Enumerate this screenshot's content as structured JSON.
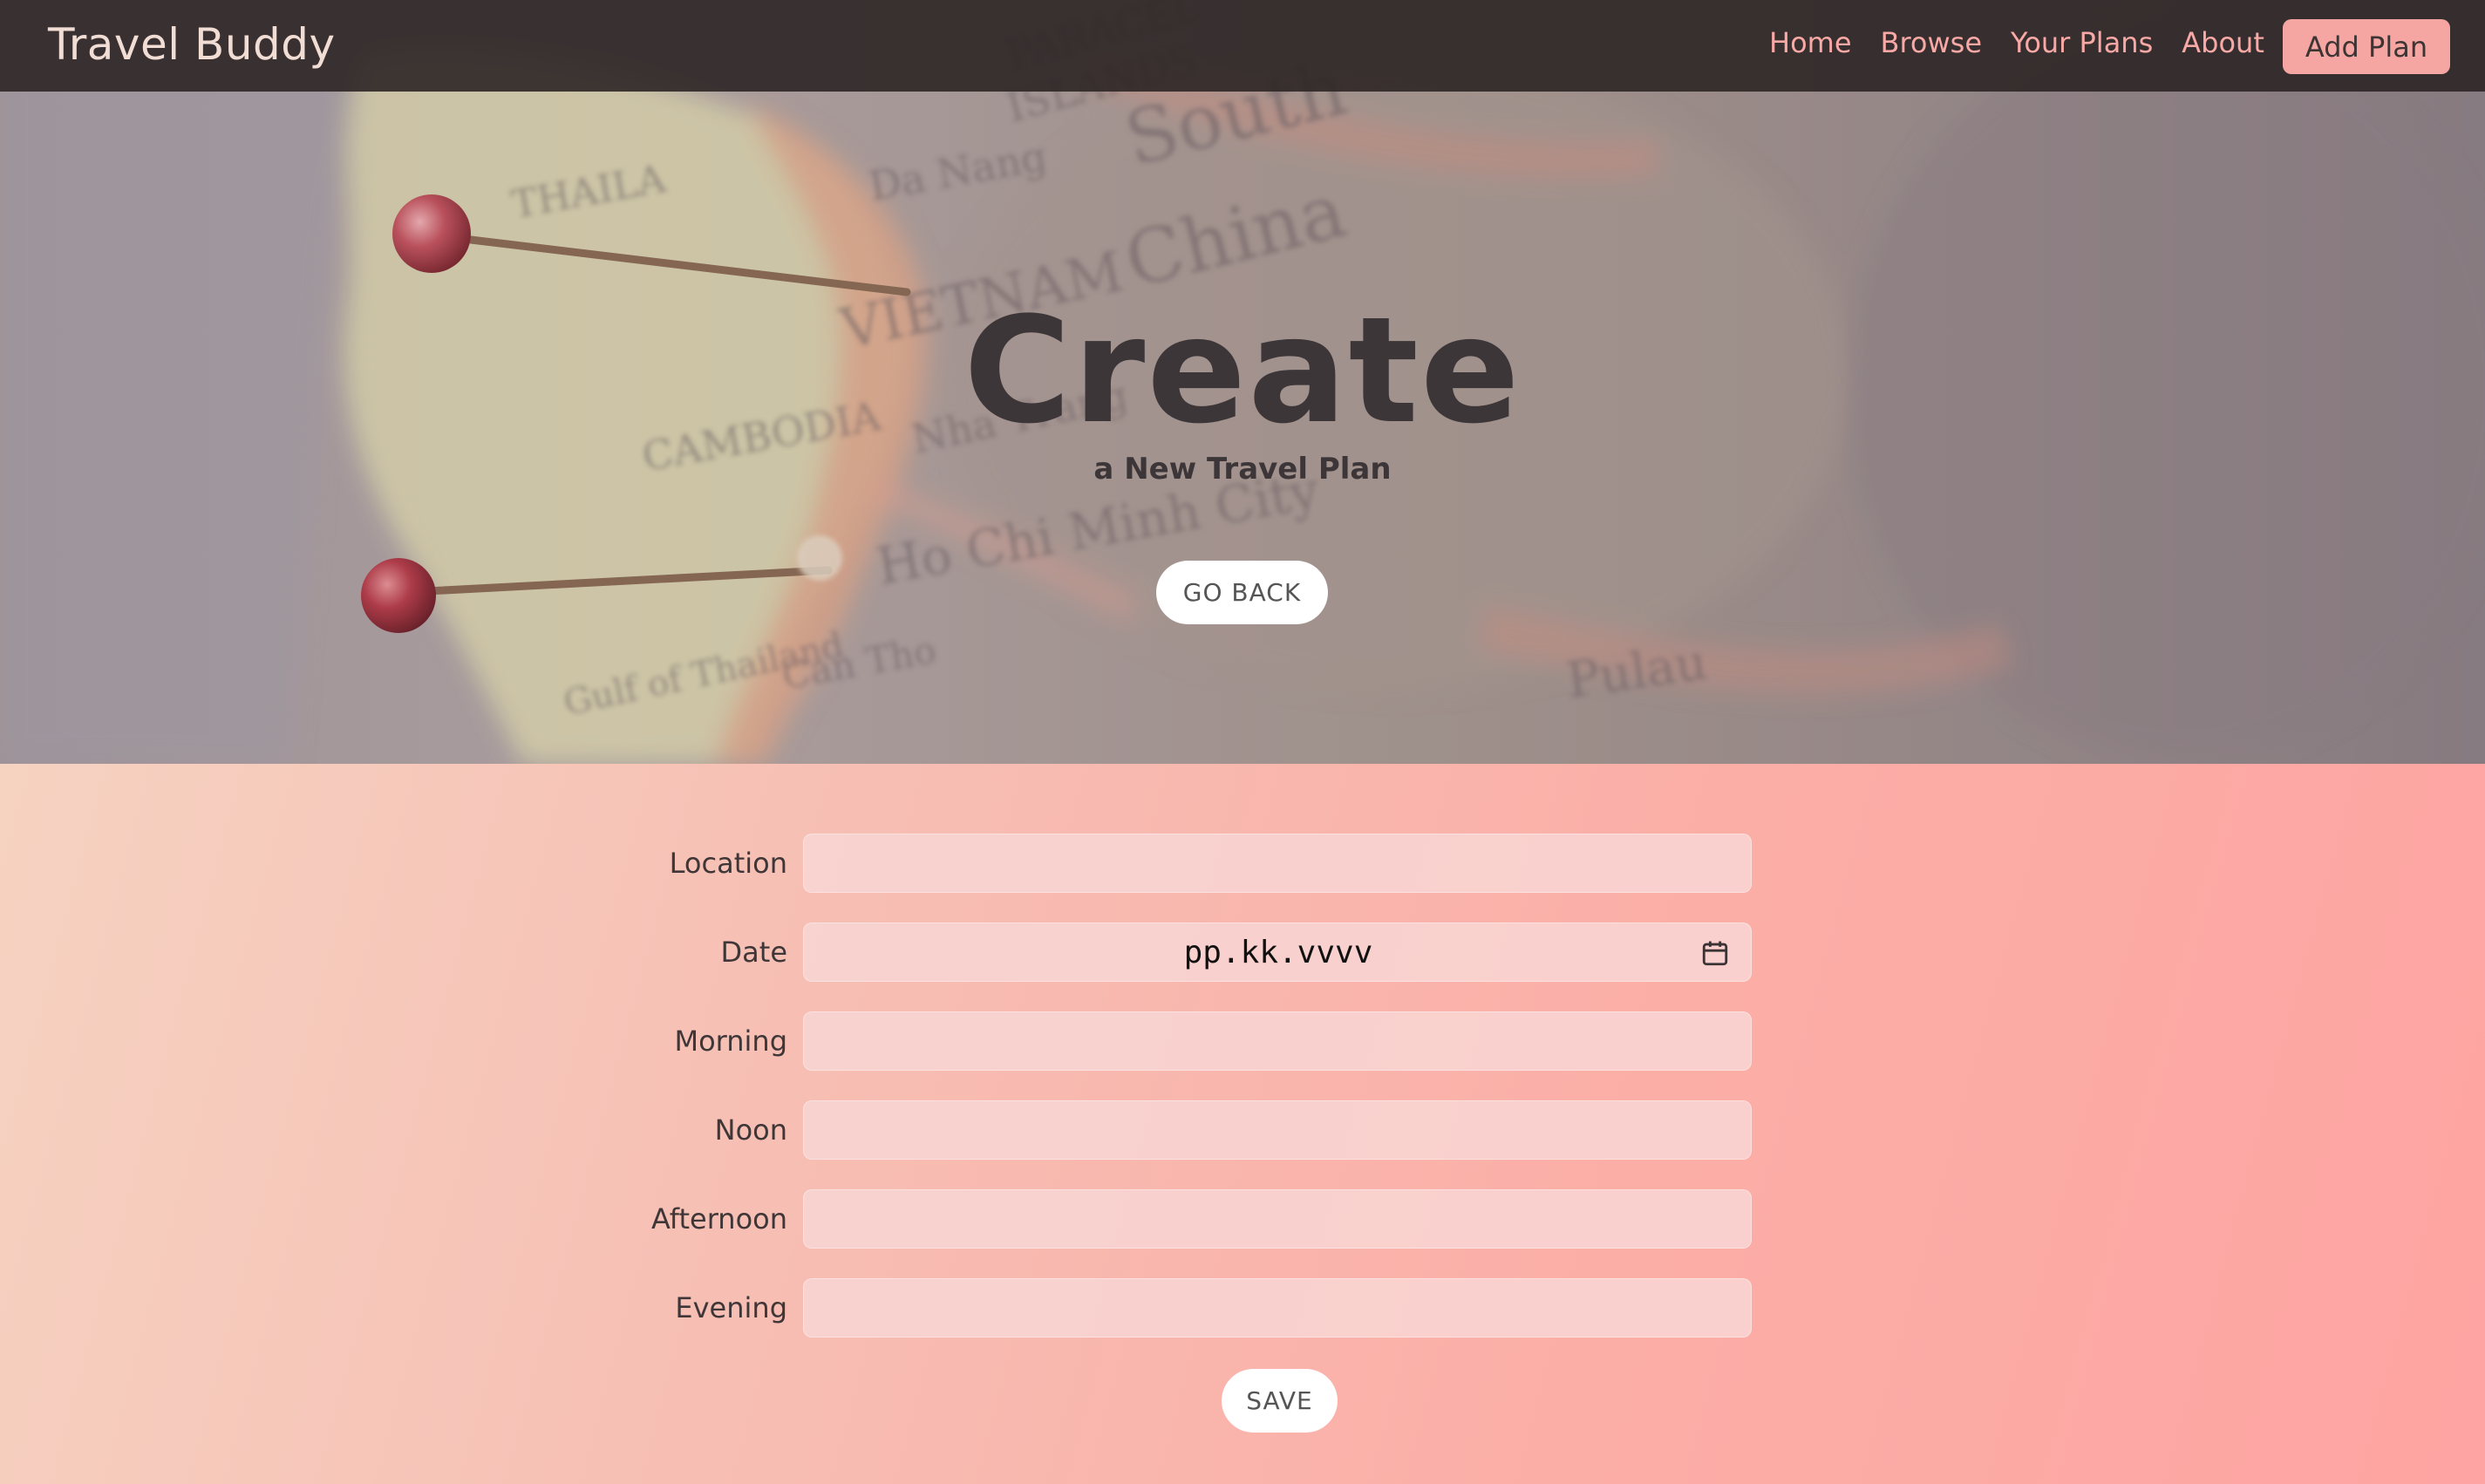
{
  "navbar": {
    "brand": "Travel Buddy",
    "links": [
      "Home",
      "Browse",
      "Your Plans",
      "About"
    ],
    "add_plan_label": "Add Plan"
  },
  "hero": {
    "title": "Create",
    "subtitle": "a New Travel Plan",
    "go_back_label": "GO BACK",
    "map_labels": [
      "PARACEL ISLANDS",
      "Da Nang",
      "South",
      "China",
      "VIETNAM",
      "THAILA",
      "CAMBODIA",
      "Nha Trang",
      "Ho Chi Minh City",
      "Gulf of Thailand",
      "Can Tho"
    ]
  },
  "form": {
    "fields": [
      {
        "label": "Location",
        "value": ""
      },
      {
        "label": "Date",
        "value": "pp.kk.vvvv"
      },
      {
        "label": "Morning",
        "value": ""
      },
      {
        "label": "Noon",
        "value": ""
      },
      {
        "label": "Afternoon",
        "value": ""
      },
      {
        "label": "Evening",
        "value": ""
      }
    ],
    "save_label": "SAVE"
  },
  "colors": {
    "navbar_bg": "#2d2626",
    "nav_link": "#f8a9a6",
    "accent_button": "#f6a6a2",
    "form_gradient_start": "#f6d2c1",
    "form_gradient_end": "#fea4a2"
  },
  "icons": [
    "calendar-icon",
    "map-pin-icon"
  ]
}
